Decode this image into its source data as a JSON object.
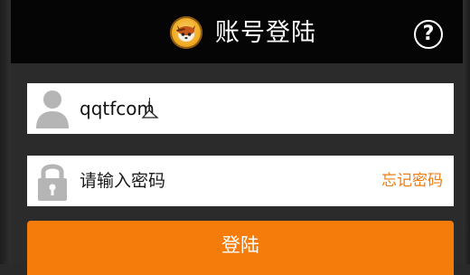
{
  "header": {
    "title": "账号登陆",
    "logo_icon": "fox-avatar-icon",
    "help_label": "?"
  },
  "username": {
    "value": "qqtfcom",
    "icon": "user-silhouette-icon"
  },
  "password": {
    "placeholder": "请输入密码",
    "icon": "padlock-icon",
    "forgot_label": "忘记密码"
  },
  "login": {
    "label": "登陆"
  },
  "colors": {
    "accent": "#f57c0a",
    "link": "#ef7d12",
    "titlebar": "#050505",
    "icon_gray": "#b0b0b0"
  }
}
